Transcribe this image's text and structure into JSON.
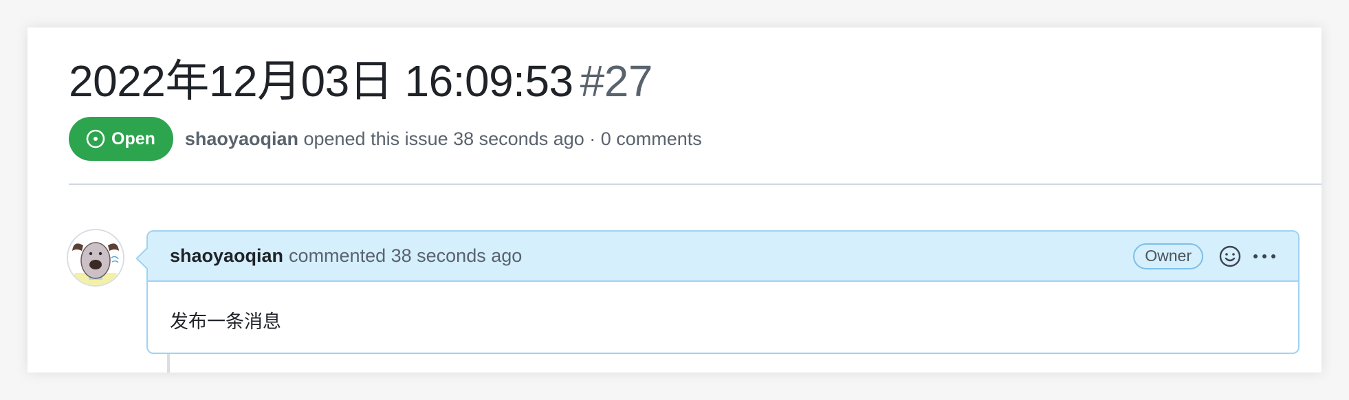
{
  "issue": {
    "title": "2022年12月03日 16:09:53",
    "number": "#27",
    "state": "Open",
    "state_color": "#2da44e",
    "meta": {
      "author": "shaoyaoqian",
      "action_text": "opened this issue 38 seconds ago · 0 comments"
    }
  },
  "comment": {
    "author": "shaoyaoqian",
    "action_text": "commented 38 seconds ago",
    "role_badge": "Owner",
    "body": "发布一条消息",
    "header_bg": "#d5effc",
    "border_color": "#9fd2f3",
    "icons": {
      "reaction": "smiley-icon",
      "more": "kebab-horizontal-icon",
      "state": "issue-opened-icon"
    }
  }
}
